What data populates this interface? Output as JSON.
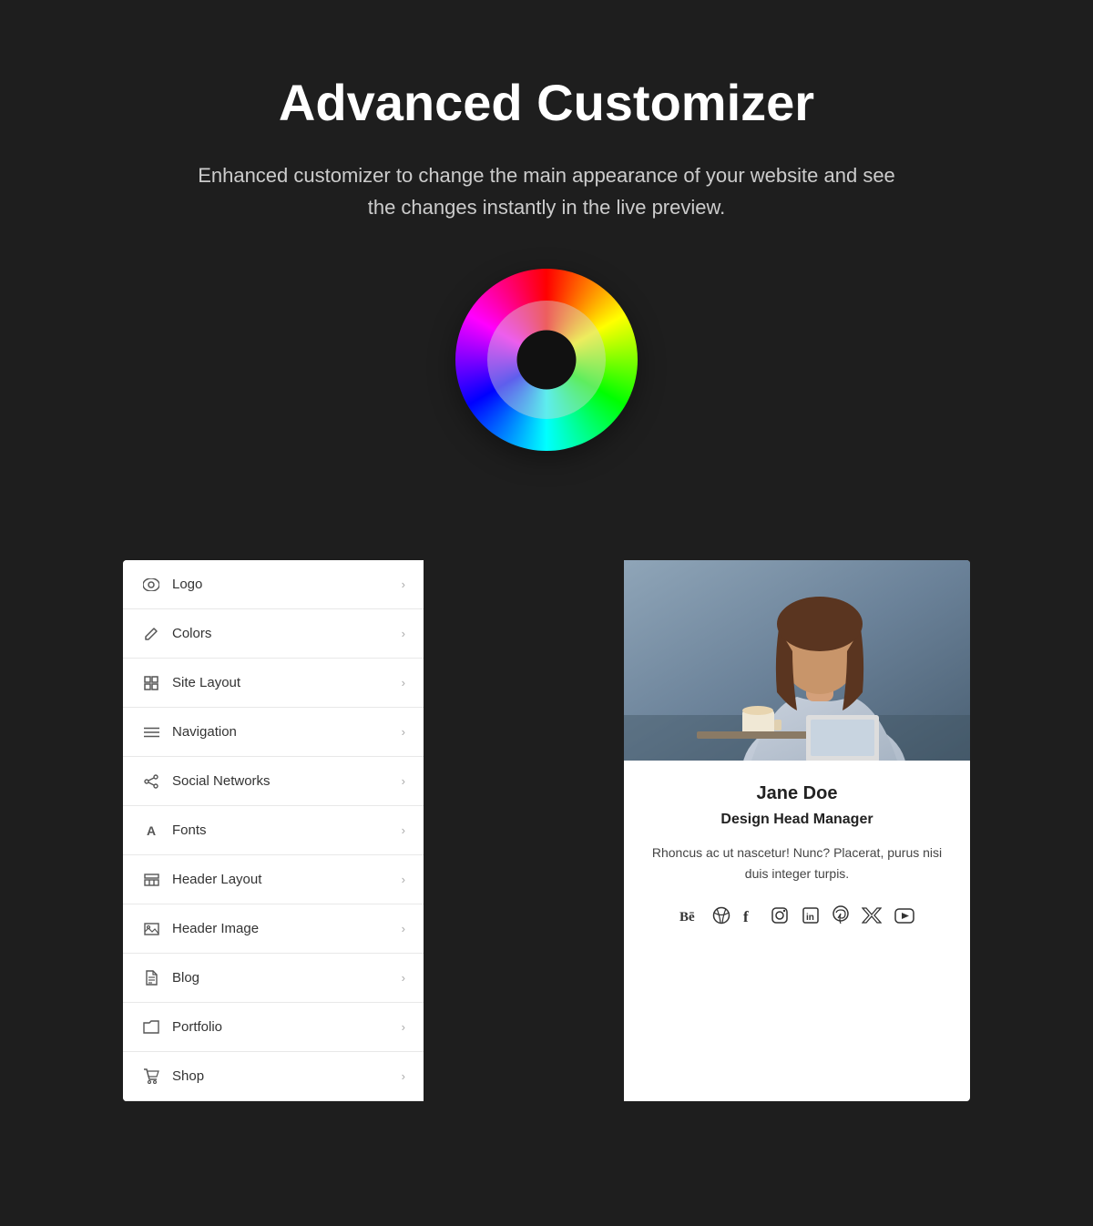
{
  "hero": {
    "title": "Advanced Customizer",
    "description": "Enhanced customizer to change the main appearance of your website and see the changes instantly in the live preview."
  },
  "sidebar": {
    "items": [
      {
        "id": "logo",
        "label": "Logo",
        "icon": "eye"
      },
      {
        "id": "colors",
        "label": "Colors",
        "icon": "pencil"
      },
      {
        "id": "site-layout",
        "label": "Site Layout",
        "icon": "grid"
      },
      {
        "id": "navigation",
        "label": "Navigation",
        "icon": "menu"
      },
      {
        "id": "social-networks",
        "label": "Social Networks",
        "icon": "share"
      },
      {
        "id": "fonts",
        "label": "Fonts",
        "icon": "a"
      },
      {
        "id": "header-layout",
        "label": "Header Layout",
        "icon": "table"
      },
      {
        "id": "header-image",
        "label": "Header Image",
        "icon": "image"
      },
      {
        "id": "blog",
        "label": "Blog",
        "icon": "doc"
      },
      {
        "id": "portfolio",
        "label": "Portfolio",
        "icon": "folder"
      },
      {
        "id": "shop",
        "label": "Shop",
        "icon": "cart"
      }
    ]
  },
  "profile": {
    "name": "Jane Doe",
    "title": "Design Head Manager",
    "bio": "Rhoncus ac ut nascetur! Nunc? Placerat, purus nisi duis integer turpis.",
    "social_icons": [
      "Bē",
      "◎",
      "f",
      "◻",
      "in",
      "◻",
      "𝕏",
      "▶"
    ]
  }
}
